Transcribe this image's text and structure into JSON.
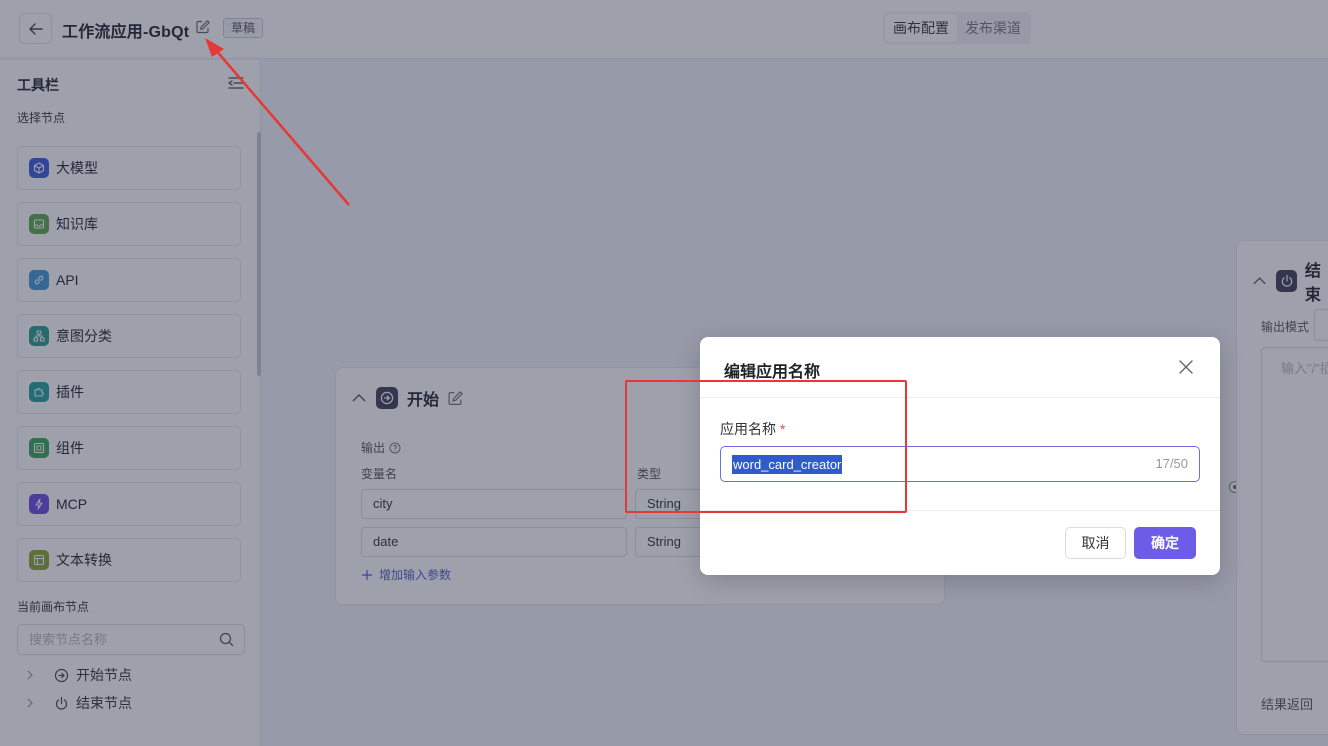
{
  "header": {
    "back_icon": "arrow-left-icon",
    "app_title": "工作流应用-GbQt",
    "edit_icon": "edit-icon",
    "badge": "草稿",
    "tabs": [
      {
        "label": "画布配置",
        "active": true
      },
      {
        "label": "发布渠道",
        "active": false
      }
    ]
  },
  "sidebar": {
    "title": "工具栏",
    "collapse_icon": "collapse-icon",
    "subtitle": "选择节点",
    "nodes": [
      {
        "label": "大模型",
        "icon": "cube-icon",
        "color": "#3b5bdb"
      },
      {
        "label": "知识库",
        "icon": "inbox-icon",
        "color": "#5fa84a"
      },
      {
        "label": "API",
        "icon": "link-icon",
        "color": "#3d9bd3"
      },
      {
        "label": "意图分类",
        "icon": "hierarchy-icon",
        "color": "#2a9d8f"
      },
      {
        "label": "插件",
        "icon": "puzzle-icon",
        "color": "#20a39e"
      },
      {
        "label": "组件",
        "icon": "component-icon",
        "color": "#3aa655"
      },
      {
        "label": "MCP",
        "icon": "bolt-icon",
        "color": "#6c4ce0"
      },
      {
        "label": "文本转换",
        "icon": "layout-icon",
        "color": "#8aa62b"
      }
    ],
    "canvas_section": "当前画布节点",
    "search_placeholder": "搜索节点名称",
    "tree": [
      {
        "label": "开始节点",
        "icon": "start-icon"
      },
      {
        "label": "结束节点",
        "icon": "power-icon"
      }
    ]
  },
  "start_card": {
    "title": "开始",
    "output_label": "输出",
    "col_name": "变量名",
    "col_type": "类型",
    "rows": [
      {
        "name": "city",
        "type": "String"
      },
      {
        "name": "date",
        "type": "String"
      }
    ],
    "add_param": "增加输入参数"
  },
  "end_card": {
    "title": "结束",
    "mode_label": "输出模式",
    "textarea_placeholder": "输入\"/\"插",
    "return_label": "结果返回"
  },
  "dialog": {
    "title": "编辑应用名称",
    "field_label": "应用名称",
    "required_mark": "*",
    "field_value": "word_card_creator",
    "counter": "17/50",
    "cancel": "取消",
    "confirm": "确定"
  },
  "colors": {
    "primary": "#6c5ce7",
    "annotation": "#e53935"
  }
}
